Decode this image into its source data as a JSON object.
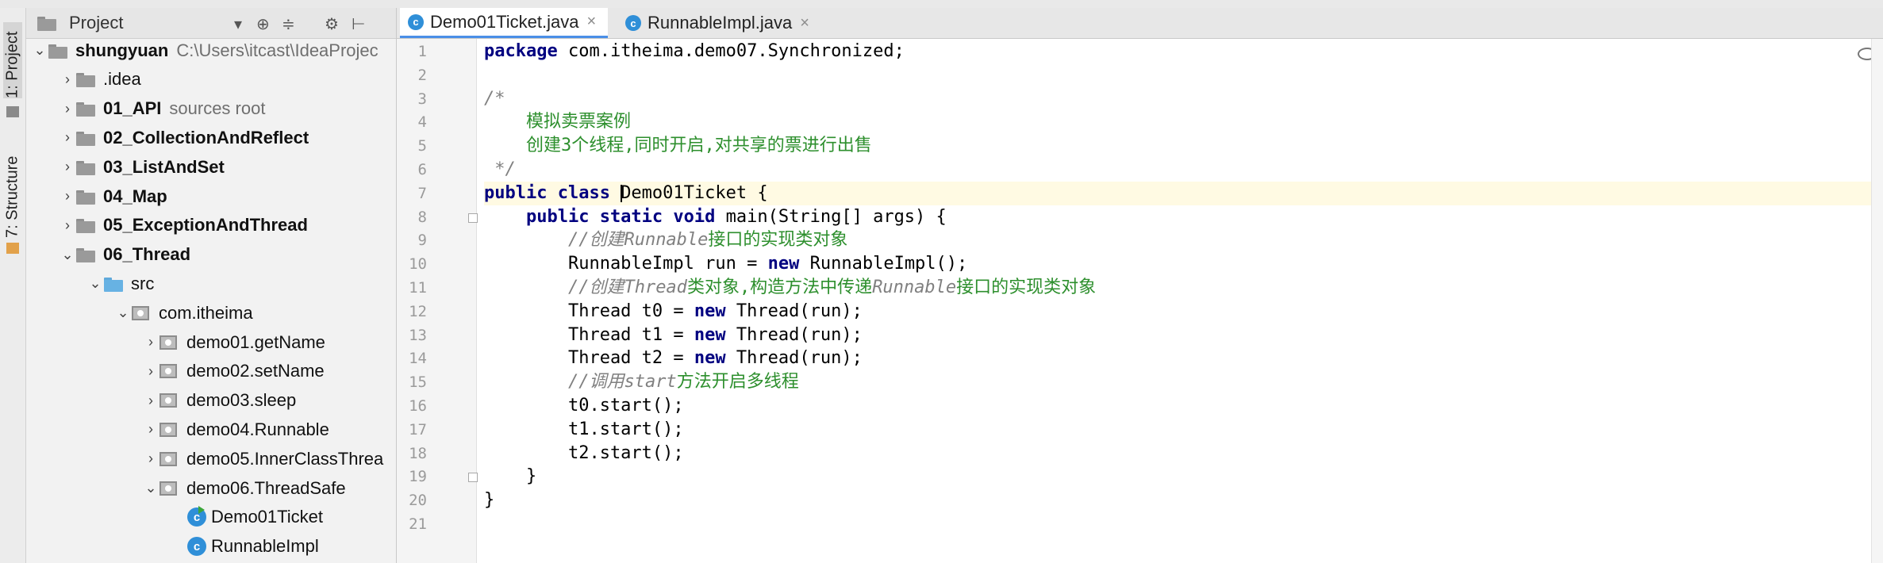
{
  "project_panel": {
    "title": "Project",
    "side_tabs": [
      "1: Project",
      "7: Structure"
    ],
    "tree": [
      {
        "label": "shungyuan",
        "hint": "C:\\Users\\itcast\\IdeaProjec",
        "bold": true,
        "depth": 0,
        "arrow": "⌄",
        "icon": "folder"
      },
      {
        "label": ".idea",
        "hint": "",
        "bold": false,
        "depth": 1,
        "arrow": "›",
        "icon": "folder"
      },
      {
        "label": "01_API",
        "hint": "sources root",
        "bold": true,
        "depth": 1,
        "arrow": "›",
        "icon": "folder"
      },
      {
        "label": "02_CollectionAndReflect",
        "hint": "",
        "bold": true,
        "depth": 1,
        "arrow": "›",
        "icon": "folder"
      },
      {
        "label": "03_ListAndSet",
        "hint": "",
        "bold": true,
        "depth": 1,
        "arrow": "›",
        "icon": "folder"
      },
      {
        "label": "04_Map",
        "hint": "",
        "bold": true,
        "depth": 1,
        "arrow": "›",
        "icon": "folder"
      },
      {
        "label": "05_ExceptionAndThread",
        "hint": "",
        "bold": true,
        "depth": 1,
        "arrow": "›",
        "icon": "folder"
      },
      {
        "label": "06_Thread",
        "hint": "",
        "bold": true,
        "depth": 1,
        "arrow": "⌄",
        "icon": "folder"
      },
      {
        "label": "src",
        "hint": "",
        "bold": false,
        "depth": 2,
        "arrow": "⌄",
        "icon": "folder-blue"
      },
      {
        "label": "com.itheima",
        "hint": "",
        "bold": false,
        "depth": 3,
        "arrow": "⌄",
        "icon": "package"
      },
      {
        "label": "demo01.getName",
        "hint": "",
        "bold": false,
        "depth": 4,
        "arrow": "›",
        "icon": "package"
      },
      {
        "label": "demo02.setName",
        "hint": "",
        "bold": false,
        "depth": 4,
        "arrow": "›",
        "icon": "package"
      },
      {
        "label": "demo03.sleep",
        "hint": "",
        "bold": false,
        "depth": 4,
        "arrow": "›",
        "icon": "package"
      },
      {
        "label": "demo04.Runnable",
        "hint": "",
        "bold": false,
        "depth": 4,
        "arrow": "›",
        "icon": "package"
      },
      {
        "label": "demo05.InnerClassThrea",
        "hint": "",
        "bold": false,
        "depth": 4,
        "arrow": "›",
        "icon": "package"
      },
      {
        "label": "demo06.ThreadSafe",
        "hint": "",
        "bold": false,
        "depth": 4,
        "arrow": "⌄",
        "icon": "package"
      },
      {
        "label": "Demo01Ticket",
        "hint": "",
        "bold": false,
        "depth": 5,
        "arrow": "",
        "icon": "class-run"
      },
      {
        "label": "RunnableImpl",
        "hint": "",
        "bold": false,
        "depth": 5,
        "arrow": "",
        "icon": "class"
      }
    ]
  },
  "editor": {
    "tabs": [
      {
        "label": "Demo01Ticket.java",
        "active": true
      },
      {
        "label": "RunnableImpl.java",
        "active": false
      }
    ],
    "current_line": 7,
    "lines": [
      [
        {
          "t": "package ",
          "c": "kw"
        },
        {
          "t": "com.itheima.demo07.Synchronized;",
          "c": ""
        }
      ],
      [],
      [
        {
          "t": "/*",
          "c": "cm"
        }
      ],
      [
        {
          "t": "    模拟卖票案例",
          "c": "cmz"
        }
      ],
      [
        {
          "t": "    创建3个线程,同时开启,对共享的票进行出售",
          "c": "cmz"
        }
      ],
      [
        {
          "t": " */",
          "c": "cm"
        }
      ],
      [
        {
          "t": "public class ",
          "c": "kw"
        },
        {
          "t": "CARET",
          "c": "caret"
        },
        {
          "t": "Demo01Ticket {",
          "c": ""
        }
      ],
      [
        {
          "t": "    public static void ",
          "c": "kw"
        },
        {
          "t": "main(String[] args) {",
          "c": ""
        }
      ],
      [
        {
          "t": "        //创建",
          "c": "cm"
        },
        {
          "t": "Runnable",
          "c": "cm"
        },
        {
          "t": "接口的实现类对象",
          "c": "cmz"
        }
      ],
      [
        {
          "t": "        RunnableImpl run = ",
          "c": ""
        },
        {
          "t": "new ",
          "c": "kw"
        },
        {
          "t": "RunnableImpl();",
          "c": ""
        }
      ],
      [
        {
          "t": "        //创建",
          "c": "cm"
        },
        {
          "t": "Thread",
          "c": "cm"
        },
        {
          "t": "类对象,构造方法中传递",
          "c": "cmz"
        },
        {
          "t": "Runnable",
          "c": "cm"
        },
        {
          "t": "接口的实现类对象",
          "c": "cmz"
        }
      ],
      [
        {
          "t": "        Thread t0 = ",
          "c": ""
        },
        {
          "t": "new ",
          "c": "kw"
        },
        {
          "t": "Thread(run);",
          "c": ""
        }
      ],
      [
        {
          "t": "        Thread t1 = ",
          "c": ""
        },
        {
          "t": "new ",
          "c": "kw"
        },
        {
          "t": "Thread(run);",
          "c": ""
        }
      ],
      [
        {
          "t": "        Thread t2 = ",
          "c": ""
        },
        {
          "t": "new ",
          "c": "kw"
        },
        {
          "t": "Thread(run);",
          "c": ""
        }
      ],
      [
        {
          "t": "        //调用",
          "c": "cm"
        },
        {
          "t": "start",
          "c": "cm"
        },
        {
          "t": "方法开启多线程",
          "c": "cmz"
        }
      ],
      [
        {
          "t": "        t0.start();",
          "c": ""
        }
      ],
      [
        {
          "t": "        t1.start();",
          "c": ""
        }
      ],
      [
        {
          "t": "        t2.start();",
          "c": ""
        }
      ],
      [
        {
          "t": "    }",
          "c": ""
        }
      ],
      [
        {
          "t": "}",
          "c": ""
        }
      ],
      []
    ]
  }
}
